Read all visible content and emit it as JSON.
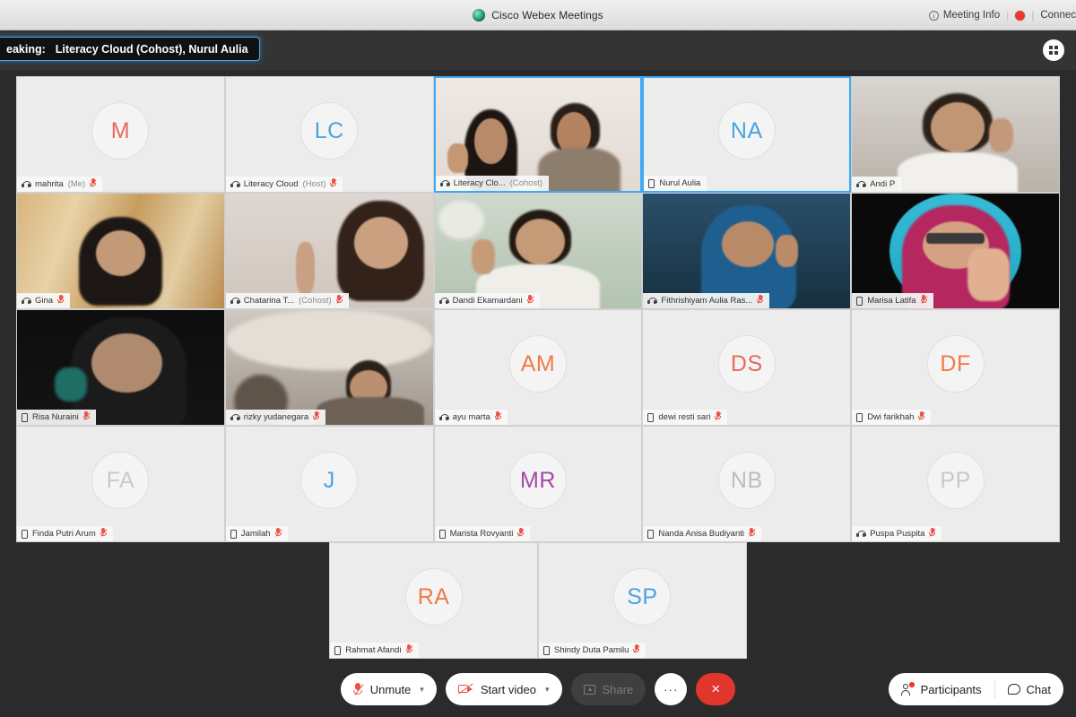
{
  "titlebar": {
    "app_title": "Cisco Webex Meetings",
    "logo_icon": "webex-logo-icon",
    "meeting_info_label": "Meeting Info",
    "meeting_info_icon": "info-circle-icon",
    "recording_indicator_icon": "recording-dot-icon",
    "connection_label": "Connec"
  },
  "speaking_bar": {
    "prefix": "eaking:",
    "speakers": "Literacy Cloud (Cohost),   Nurul Aulia",
    "layout_icon": "grid-layout-icon"
  },
  "participants": [
    [
      {
        "name": "mahrita",
        "role": "(Me)",
        "initials": "M",
        "color": "#e8685e",
        "kind": "avatar",
        "device": "headset",
        "muted": true,
        "active": false
      },
      {
        "name": "Literacy Cloud",
        "role": "(Host)",
        "initials": "LC",
        "color": "#4aa3e0",
        "kind": "avatar",
        "device": "headset",
        "muted": true,
        "active": false
      },
      {
        "name": "Literacy Clo...",
        "role": "(Cohost)",
        "initials": "",
        "color": "",
        "kind": "video",
        "video": "two-people-light",
        "device": "headset",
        "muted": false,
        "active": true
      },
      {
        "name": "Nurul Aulia",
        "role": "",
        "initials": "NA",
        "color": "#4aa3e0",
        "kind": "avatar",
        "device": "phone",
        "muted": false,
        "active": true
      },
      {
        "name": "Andi P",
        "role": "",
        "initials": "",
        "color": "",
        "kind": "video",
        "video": "man-white-shirt",
        "device": "headset",
        "muted": false,
        "active": false
      }
    ],
    [
      {
        "name": "Gina",
        "role": "",
        "initials": "",
        "color": "",
        "kind": "video",
        "video": "hijab-window",
        "device": "headset",
        "muted": true,
        "active": false
      },
      {
        "name": "Chatarina T...",
        "role": "(Cohost)",
        "initials": "",
        "color": "",
        "kind": "video",
        "video": "woman-pointing",
        "device": "headset",
        "muted": true,
        "active": false
      },
      {
        "name": "Dandi Ekamardani",
        "role": "",
        "initials": "",
        "color": "",
        "kind": "video",
        "video": "man-green-wall",
        "device": "headset",
        "muted": true,
        "active": false
      },
      {
        "name": "Fithrishiyam Aulia Ras...",
        "role": "",
        "initials": "",
        "color": "",
        "kind": "video",
        "video": "woman-blue-hijab",
        "device": "headset",
        "muted": true,
        "active": false
      },
      {
        "name": "Marisa Latifa",
        "role": "",
        "initials": "",
        "color": "",
        "kind": "video",
        "video": "woman-glasses-pink",
        "device": "phone",
        "muted": true,
        "active": false
      }
    ],
    [
      {
        "name": "Risa Nuraini",
        "role": "",
        "initials": "",
        "color": "",
        "kind": "video",
        "video": "dark-room-hijab",
        "device": "phone",
        "muted": true,
        "active": false
      },
      {
        "name": "rizky yudanegara",
        "role": "",
        "initials": "",
        "color": "",
        "kind": "video",
        "video": "man-room-desk",
        "device": "headset",
        "muted": true,
        "active": false
      },
      {
        "name": "ayu marta",
        "role": "",
        "initials": "AM",
        "color": "#ef7b45",
        "kind": "avatar",
        "device": "headset",
        "muted": true,
        "active": false
      },
      {
        "name": "dewi resti sari",
        "role": "",
        "initials": "DS",
        "color": "#e8685e",
        "kind": "avatar",
        "device": "phone",
        "muted": true,
        "active": false
      },
      {
        "name": "Dwi farikhah",
        "role": "",
        "initials": "DF",
        "color": "#ef7b45",
        "kind": "avatar",
        "device": "phone",
        "muted": true,
        "active": false
      }
    ],
    [
      {
        "name": "Finda Putri Arum",
        "role": "",
        "initials": "FA",
        "color": "#c9c9c9",
        "kind": "avatar",
        "device": "phone",
        "muted": true,
        "active": false
      },
      {
        "name": "Jamilah",
        "role": "",
        "initials": "J",
        "color": "#4aa3e0",
        "kind": "avatar",
        "device": "phone",
        "muted": true,
        "active": false
      },
      {
        "name": "Marista Rovyanti",
        "role": "",
        "initials": "MR",
        "color": "#a349a4",
        "kind": "avatar",
        "device": "phone",
        "muted": true,
        "active": false
      },
      {
        "name": "Nanda Anisa Budiyanti",
        "role": "",
        "initials": "NB",
        "color": "#bdbdbd",
        "kind": "avatar",
        "device": "phone",
        "muted": true,
        "active": false
      },
      {
        "name": "Puspa Puspita",
        "role": "",
        "initials": "PP",
        "color": "#c9c9c9",
        "kind": "avatar",
        "device": "headset",
        "muted": true,
        "active": false
      }
    ],
    [
      {
        "name": "Rahmat Afandi",
        "role": "",
        "initials": "RA",
        "color": "#ef7b45",
        "kind": "avatar",
        "device": "phone",
        "muted": true,
        "active": false
      },
      {
        "name": "Shindy Duta Pamilu",
        "role": "",
        "initials": "SP",
        "color": "#4aa3e0",
        "kind": "avatar",
        "device": "phone",
        "muted": true,
        "active": false
      }
    ]
  ],
  "toolbar": {
    "unmute_label": "Unmute",
    "unmute_icon": "mic-off-icon",
    "start_video_label": "Start video",
    "start_video_icon": "camera-off-icon",
    "share_label": "Share",
    "share_icon": "share-screen-icon",
    "more_label": "···",
    "more_icon": "more-options-icon",
    "end_label": "×",
    "end_icon": "end-call-icon",
    "participants_label": "Participants",
    "participants_icon": "participants-icon",
    "chat_label": "Chat",
    "chat_icon": "chat-bubble-icon",
    "chevron": "⌄"
  },
  "colors": {
    "accent_blue": "#3fa9f5",
    "end_red": "#e0362c",
    "mute_red": "#e8544a",
    "stage_bg": "#2b2b2b"
  }
}
